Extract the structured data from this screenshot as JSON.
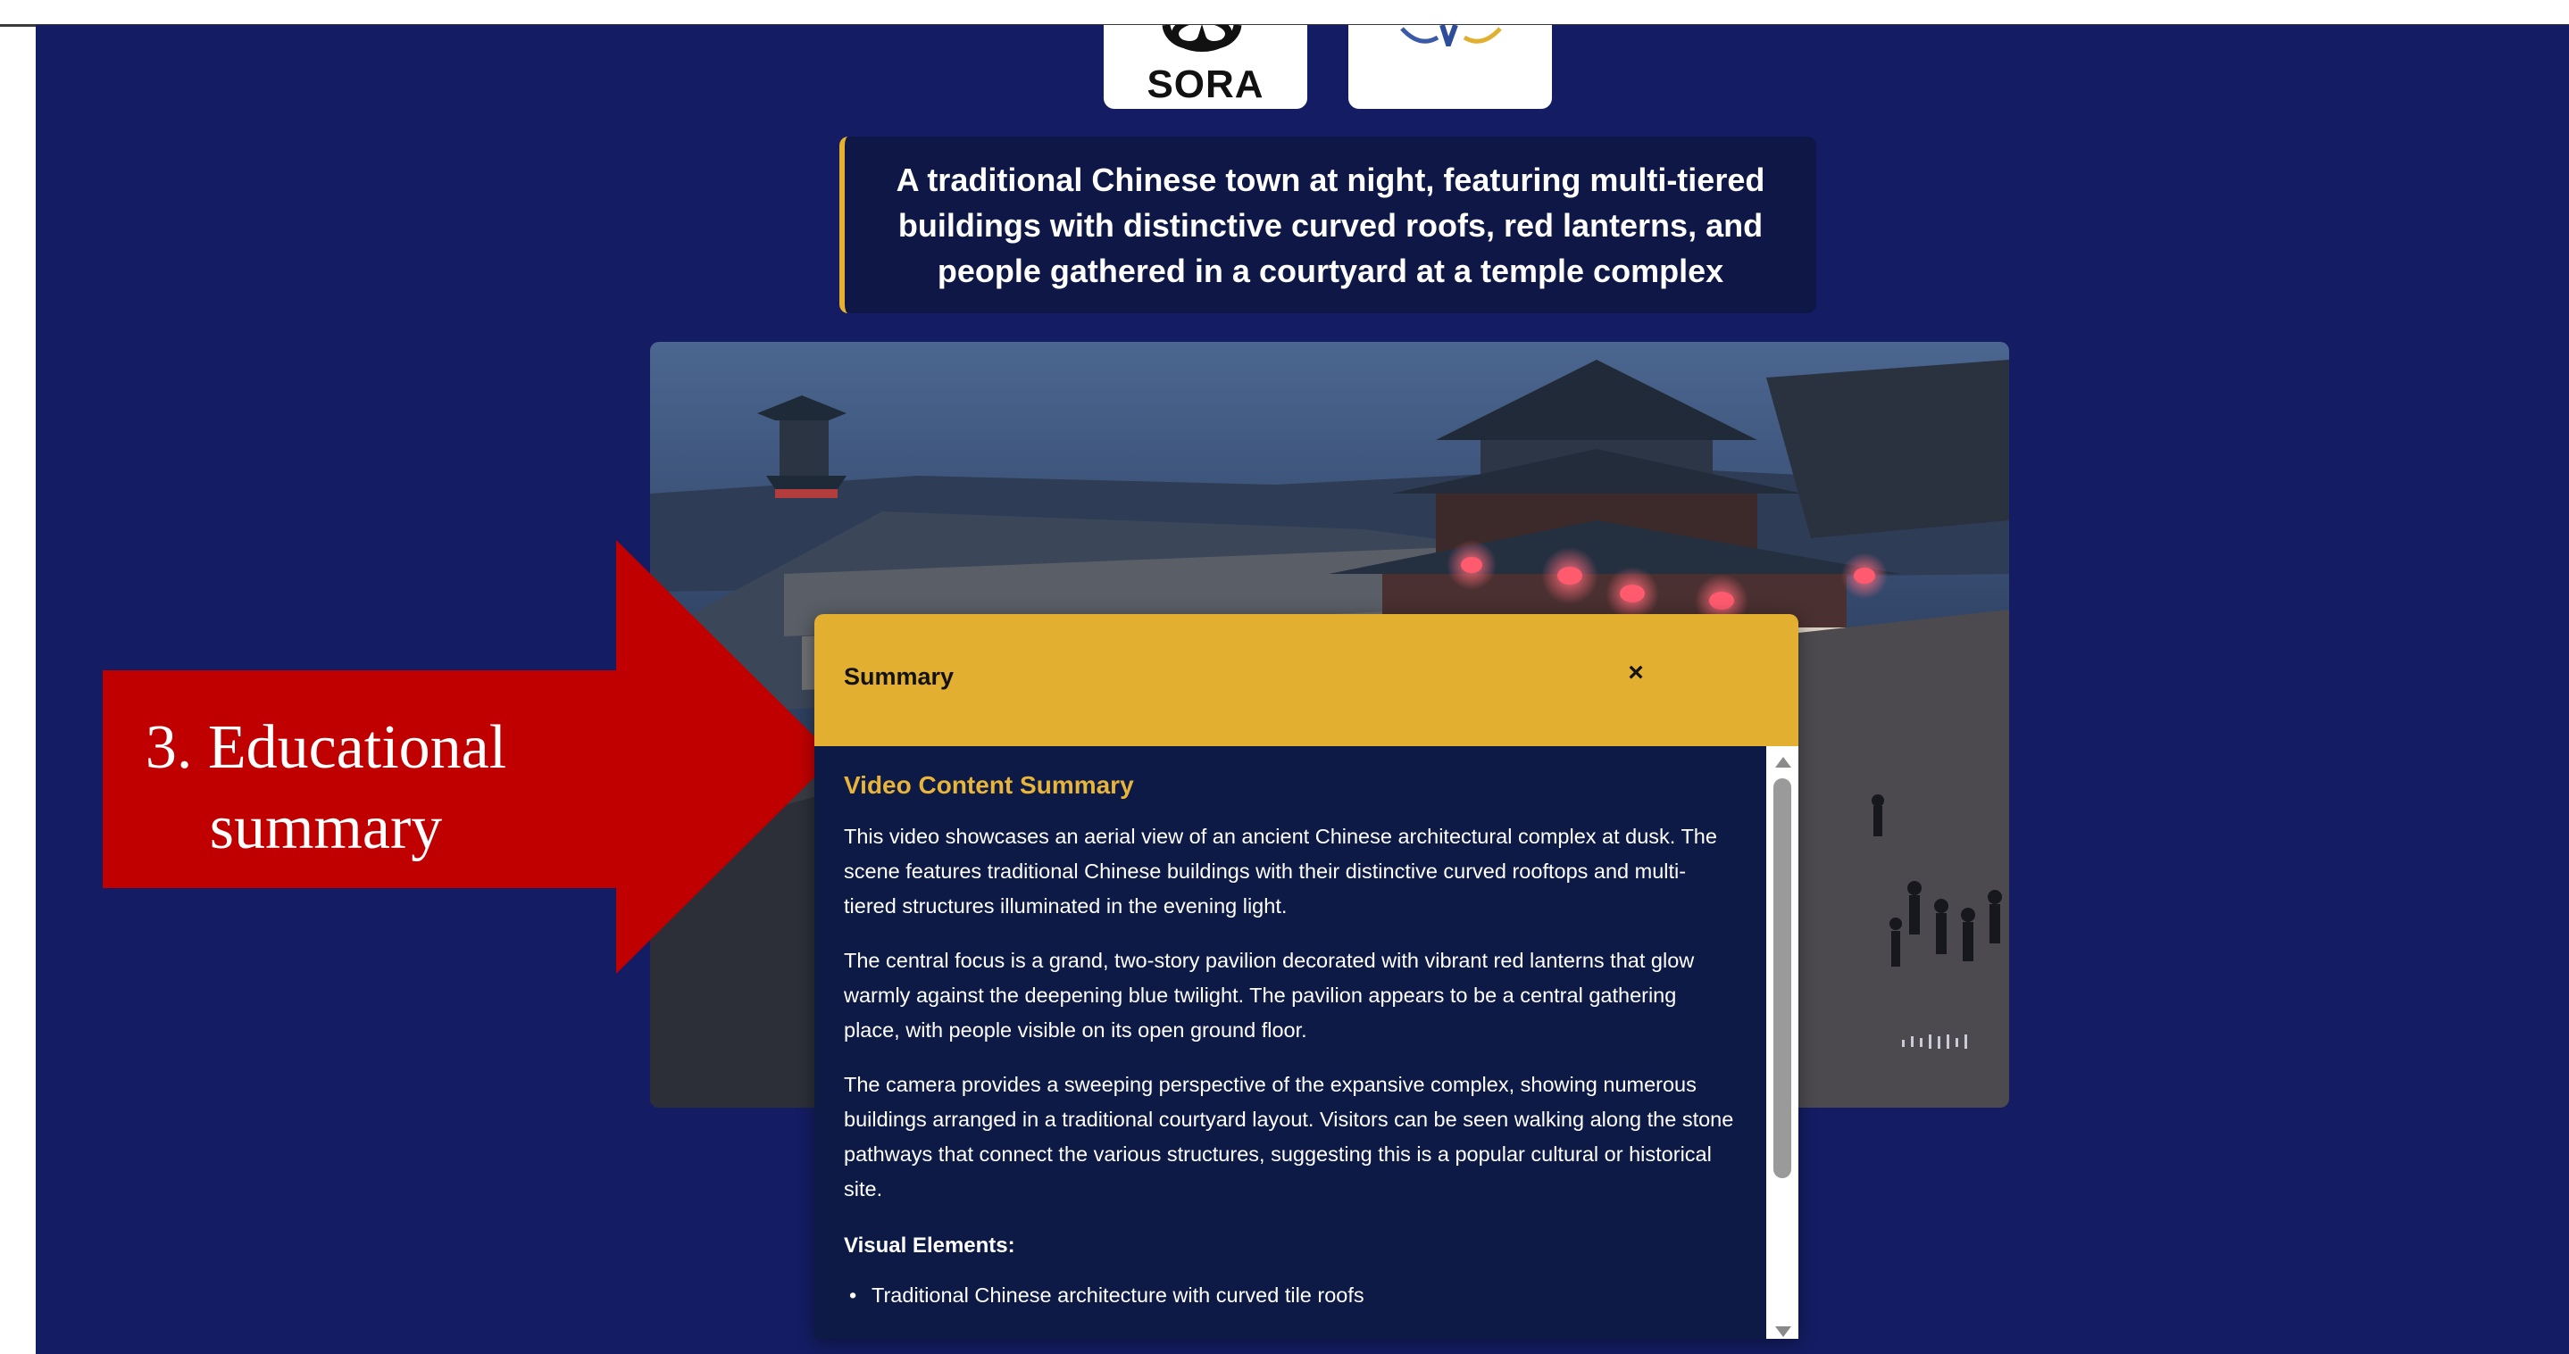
{
  "logos": {
    "sora_label": "SORA"
  },
  "caption": {
    "text": "A traditional Chinese town at night, featuring multi-tiered buildings with distinctive curved roofs, red lanterns, and people gathered in a courtyard at a temple complex"
  },
  "callout": {
    "line1": "3. Educational",
    "line2": "summary",
    "color": "#c00000"
  },
  "modal": {
    "title": "Summary",
    "close_symbol": "×",
    "heading": "Video Content Summary",
    "paragraphs": [
      "This video showcases an aerial view of an ancient Chinese architectural complex at dusk. The scene features traditional Chinese buildings with their distinctive curved rooftops and multi-tiered structures illuminated in the evening light.",
      "The central focus is a grand, two-story pavilion decorated with vibrant red lanterns that glow warmly against the deepening blue twilight. The pavilion appears to be a central gathering place, with people visible on its open ground floor.",
      "The camera provides a sweeping perspective of the expansive complex, showing numerous buildings arranged in a traditional courtyard layout. Visitors can be seen walking along the stone pathways that connect the various structures, suggesting this is a popular cultural or historical site."
    ],
    "visual_heading": "Visual Elements:",
    "visual_items": [
      "Traditional Chinese architecture with curved tile roofs"
    ]
  },
  "colors": {
    "page_background": "#141d63",
    "accent_gold": "#e3af30",
    "modal_background": "#0d1a46",
    "heading_gold": "#e8b53a"
  },
  "icons": {
    "close": "close-icon",
    "scroll_up": "scroll-up-arrow-icon",
    "scroll_down": "scroll-down-arrow-icon"
  }
}
